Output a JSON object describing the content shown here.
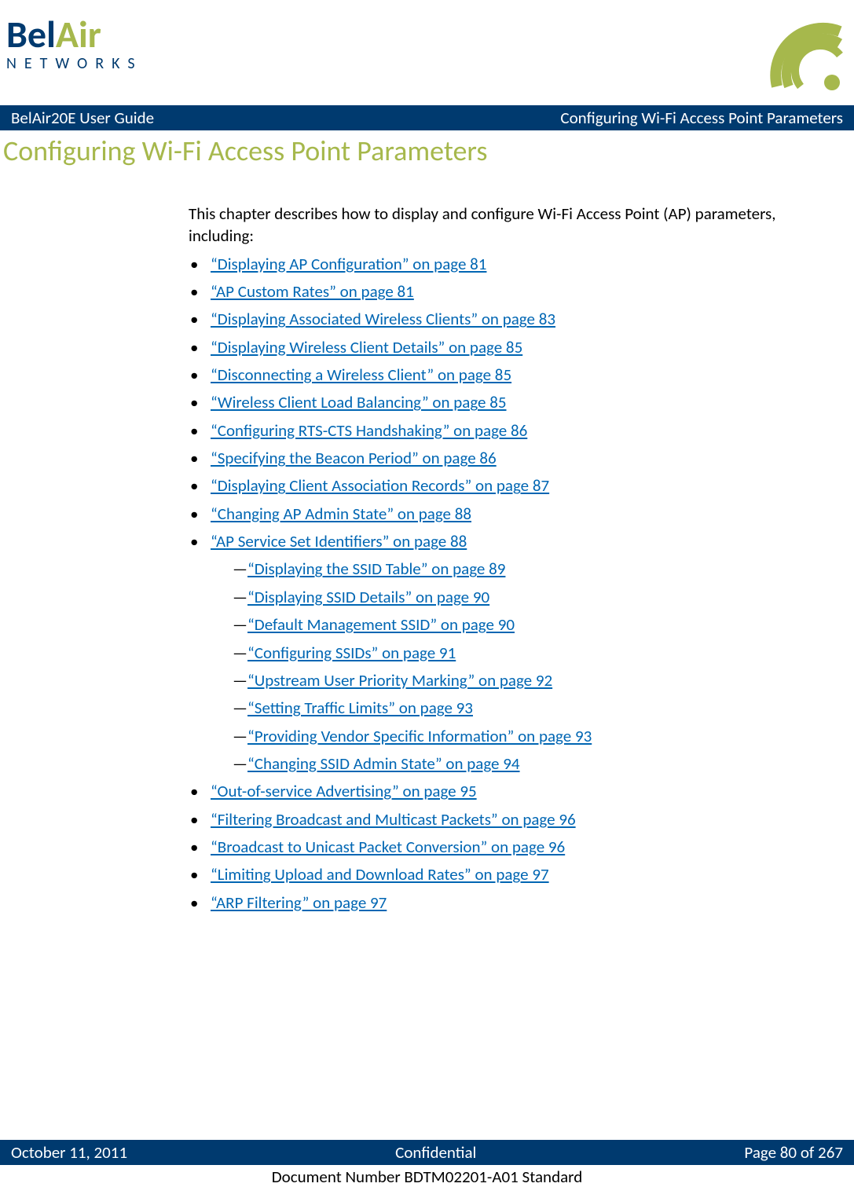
{
  "logo": {
    "word1_part1": "Bel",
    "word1_part2": "Air",
    "word2": "NETWORKS"
  },
  "header": {
    "left": "BelAir20E User Guide",
    "right": "Configuring Wi-Fi Access Point Parameters"
  },
  "chapter_title": "Configuring Wi-Fi Access Point Parameters",
  "intro": "This chapter describes how to display and configure Wi-Fi Access Point (AP) parameters, including:",
  "toc": [
    {
      "label": "“Displaying AP Configuration” on page 81"
    },
    {
      "label": "“AP Custom Rates” on page 81"
    },
    {
      "label": "“Displaying Associated Wireless Clients” on page 83"
    },
    {
      "label": "“Displaying Wireless Client Details” on page 85"
    },
    {
      "label": "“Disconnecting a Wireless Client” on page 85"
    },
    {
      "label": "“Wireless Client Load Balancing” on page 85"
    },
    {
      "label": "“Configuring RTS-CTS Handshaking” on page 86"
    },
    {
      "label": "“Specifying the Beacon Period” on page 86"
    },
    {
      "label": "“Displaying Client Association Records” on page 87"
    },
    {
      "label": "“Changing AP Admin State” on page 88"
    },
    {
      "label": "“AP Service Set Identifiers” on page 88",
      "sub": [
        {
          "label": "“Displaying the SSID Table” on page 89"
        },
        {
          "label": "“Displaying SSID Details” on page 90"
        },
        {
          "label": "“Default Management SSID” on page 90"
        },
        {
          "label": "“Configuring SSIDs” on page 91"
        },
        {
          "label": "“Upstream User Priority Marking” on page 92"
        },
        {
          "label": "“Setting Traffic Limits” on page 93"
        },
        {
          "label": "“Providing Vendor Specific Information” on page 93"
        },
        {
          "label": "“Changing SSID Admin State” on page 94"
        }
      ]
    },
    {
      "label": "“Out-of-service Advertising” on page 95"
    },
    {
      "label": "“Filtering Broadcast and Multicast Packets” on page 96"
    },
    {
      "label": "“Broadcast to Unicast Packet Conversion” on page 96"
    },
    {
      "label": "“Limiting Upload and Download Rates” on page 97"
    },
    {
      "label": "“ARP Filtering” on page 97"
    }
  ],
  "footer": {
    "left": "October 11, 2011",
    "center": "Confidential",
    "right": "Page 80 of 267"
  },
  "docnum": "Document Number BDTM02201-A01 Standard"
}
